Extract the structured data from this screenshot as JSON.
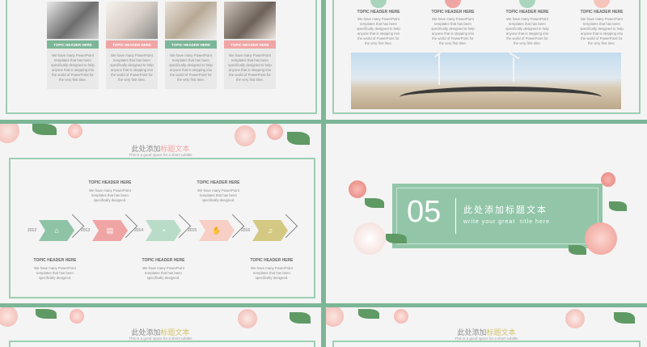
{
  "colors": {
    "green": "#7cb697",
    "pink": "#f0a5a5",
    "mint": "#a9d4bd",
    "peach": "#f5c4bb",
    "olive": "#cdc57c",
    "frame": "#9ccfb3"
  },
  "slide1": {
    "cards": [
      {
        "header": "TOPIC HEADER HERE",
        "text": "We have many PowerPoint templates that has been specifically designed to help anyone that is stepping into the world of PowerPoint for the very first time.",
        "color": "#7cb697",
        "photo": "laptop-desk-photo"
      },
      {
        "header": "TOPIC HEADER HERE",
        "text": "We have many PowerPoint templates that has been specifically designed to help anyone that is stepping into the world of PowerPoint for the very first time.",
        "color": "#f0a5a5",
        "photo": "tablet-desk-photo"
      },
      {
        "header": "TOPIC HEADER HERE",
        "text": "We have many PowerPoint templates that has been specifically designed to help anyone that is stepping into the world of PowerPoint for the very first time.",
        "color": "#7cb697",
        "photo": "keyboard-desk-photo"
      },
      {
        "header": "TOPIC HEADER HERE",
        "text": "We have many PowerPoint templates that has been specifically designed to help anyone that is stepping into the world of PowerPoint for the very first time.",
        "color": "#f0a5a5",
        "photo": "laptop-hand-photo"
      }
    ]
  },
  "slide2": {
    "columns": [
      {
        "header": "TOPIC HEADER HERE",
        "text": "We have many PowerPoint templates that has been specifically designed to help anyone that is stepping into the world of PowerPoint for the very first time.",
        "color": "#a9d4bd"
      },
      {
        "header": "TOPIC HEADER HERE",
        "text": "We have many PowerPoint templates that has been specifically designed to help anyone that is stepping into the world of PowerPoint for the very first time.",
        "color": "#f0a5a5"
      },
      {
        "header": "TOPIC HEADER HERE",
        "text": "We have many PowerPoint templates that has been specifically designed to help anyone that is stepping into the world of PowerPoint for the very first time.",
        "color": "#a9d4bd"
      },
      {
        "header": "TOPIC HEADER HERE",
        "text": "We have many PowerPoint templates that has been specifically designed to help anyone that is stepping into the world of PowerPoint for the very first time.",
        "color": "#f5c4bb"
      }
    ],
    "photo": "wind-turbine-road-photo"
  },
  "slide3": {
    "title_main": "此处添加",
    "title_accent": "标题文本",
    "subtitle": "This is a good space for a short subtitle",
    "years": [
      "2012",
      "2013",
      "2014",
      "2015",
      "2016"
    ],
    "top_items": [
      {
        "header": "TOPIC HEADER HERE",
        "text": "We have many PowerPoint templates that has been specifically designed."
      },
      {
        "header": "TOPIC HEADER HERE",
        "text": "We have many PowerPoint templates that has been specifically designed."
      }
    ],
    "bottom_items": [
      {
        "header": "TOPIC HEADER HERE",
        "text": "We have many PowerPoint templates that has been specifically designed."
      },
      {
        "header": "TOPIC HEADER HERE",
        "text": "We have many PowerPoint templates that has been specifically designed."
      },
      {
        "header": "TOPIC HEADER HERE",
        "text": "We have many PowerPoint templates that has been specifically designed."
      }
    ]
  },
  "slide4": {
    "number": "05",
    "title": "此处添加标题文本",
    "subtitle": "write your great  title here"
  },
  "slide5": {
    "title_main": "此处添加",
    "title_accent": "标题文本",
    "subtitle": "This is a good space for a short subtitle"
  },
  "slide6": {
    "title_main": "此处添加",
    "title_accent": "标题文本",
    "subtitle": "This is a good space for a short subtitle"
  }
}
